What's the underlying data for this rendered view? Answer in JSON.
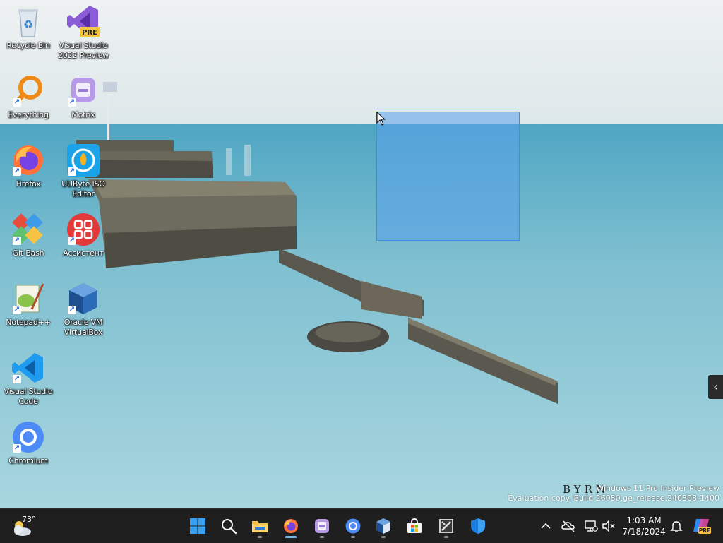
{
  "desktop": {
    "icons": [
      {
        "name": "recycle-bin",
        "label": "Recycle Bin"
      },
      {
        "name": "visual-studio-2022-preview",
        "label": "Visual Studio 2022 Preview"
      },
      {
        "name": "everything",
        "label": "Everything"
      },
      {
        "name": "motrix",
        "label": "Motrix"
      },
      {
        "name": "firefox",
        "label": "Firefox"
      },
      {
        "name": "uubyte-iso-editor",
        "label": "UUByte ISO Editor"
      },
      {
        "name": "git-bash",
        "label": "Git Bash"
      },
      {
        "name": "assistant",
        "label": "Ассистент"
      },
      {
        "name": "notepadpp",
        "label": "Notepad++"
      },
      {
        "name": "oracle-vm-virtualbox",
        "label": "Oracle VM VirtualBox"
      },
      {
        "name": "visual-studio-code",
        "label": "Visual Studio Code"
      },
      {
        "name": "chromium",
        "label": "Chromium"
      }
    ],
    "vs_badge": "PRE"
  },
  "watermark": {
    "line1": "Windows 11 Pro Insider Preview",
    "line2": "Evaluation copy. Build 26080.ge_release.240308-1400",
    "brand": "BYRN"
  },
  "side_tab": {
    "icon": "chevron-left-icon",
    "glyph": "‹"
  },
  "taskbar": {
    "weather": {
      "temp": "73°",
      "icon": "cloud-sun-icon"
    },
    "apps": [
      "start",
      "search",
      "file-explorer",
      "firefox",
      "motrix",
      "chromium",
      "virtualbox",
      "microsoft-store",
      "terminal",
      "windows-security"
    ],
    "tray": {
      "time": "1:03 AM",
      "date": "7/18/2024"
    },
    "copilot_badge": "PRE"
  },
  "colors": {
    "taskbar": "#1f1f1f",
    "selection_fill": "#5aa0eb",
    "selection_border": "#3c8ee6",
    "accent": "#0078d4"
  }
}
